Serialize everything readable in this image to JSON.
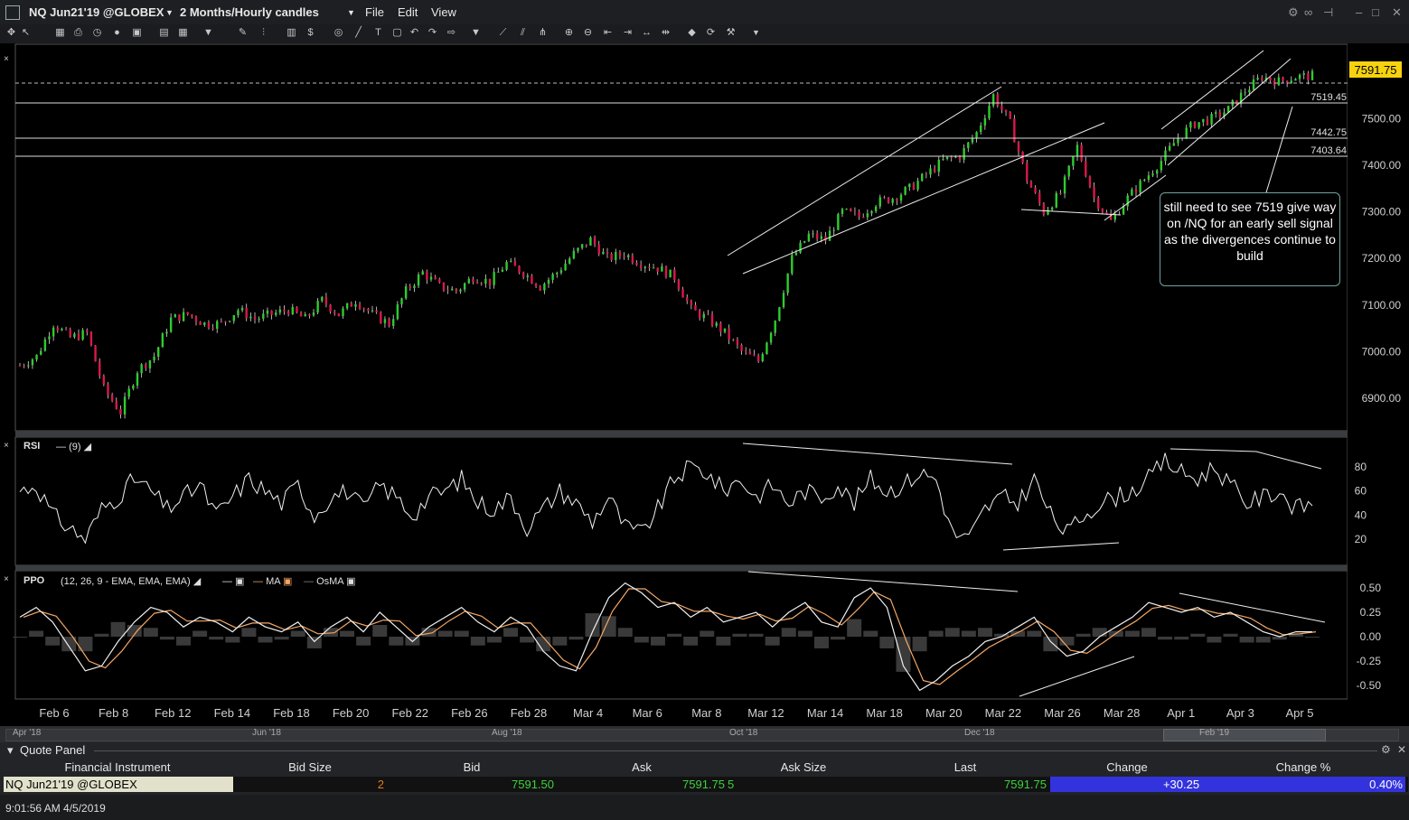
{
  "window": {
    "symbol": "NQ Jun21'19 @GLOBEX",
    "timeframe": "2 Months/Hourly candles",
    "menu": [
      "File",
      "Edit",
      "View"
    ]
  },
  "chart_data": [
    {
      "type": "line",
      "title": "",
      "x_labels": [
        "Feb 6",
        "Feb 8",
        "Feb 12",
        "Feb 14",
        "Feb 18",
        "Feb 20",
        "Feb 22",
        "Feb 26",
        "Feb 28",
        "Mar 4",
        "Mar 6",
        "Mar 8",
        "Mar 12",
        "Mar 14",
        "Mar 18",
        "Mar 20",
        "Mar 22",
        "Mar 26",
        "Mar 28",
        "Apr 1",
        "Apr 3",
        "Apr 5"
      ],
      "y_ticks": [
        "7500.00",
        "7400.00",
        "7300.00",
        "7200.00",
        "7100.00",
        "7000.00",
        "6900.00"
      ],
      "ylim": [
        6830,
        7660
      ],
      "series": [
        {
          "values": [
            6970,
            6990,
            7060,
            7030,
            7040,
            6920,
            6870,
            6960,
            6990,
            7070,
            7080,
            7060,
            7060,
            7090,
            7070,
            7080,
            7090,
            7070,
            7110,
            7080,
            7110,
            7080,
            7060,
            7130,
            7170,
            7140,
            7130,
            7160,
            7150,
            7190,
            7170,
            7140,
            7170,
            7210,
            7240,
            7200,
            7210,
            7190,
            7180,
            7160,
            7090,
            7070,
            7040,
            7000,
            6980,
            7070,
            7200,
            7250,
            7240,
            7300,
            7290,
            7320,
            7330,
            7350,
            7380,
            7410,
            7420,
            7470,
            7550,
            7490,
            7370,
            7300,
            7340,
            7440,
            7330,
            7280,
            7330,
            7370,
            7410,
            7460,
            7490,
            7500,
            7520,
            7560,
            7590,
            7580,
            7590,
            7592
          ]
        }
      ],
      "price_label": "7591.75",
      "horizontal_levels": [
        "7519.45",
        "7442.75",
        "7403.64"
      ],
      "annotation": "still need to see 7519 give way on /NQ for an early sell signal as the divergences continue to build"
    },
    {
      "type": "line",
      "title": "RSI",
      "legend": "(9)",
      "y_ticks": [
        "80",
        "60",
        "40",
        "20"
      ],
      "ylim": [
        0,
        100
      ],
      "series": [
        {
          "values": [
            60,
            65,
            40,
            30,
            20,
            45,
            55,
            70,
            60,
            45,
            55,
            65,
            40,
            55,
            70,
            60,
            50,
            65,
            40,
            55,
            60,
            45,
            65,
            55,
            40,
            55,
            60,
            70,
            50,
            45,
            55,
            30,
            45,
            60,
            50,
            35,
            55,
            30,
            25,
            45,
            70,
            80,
            75,
            60,
            70,
            55,
            65,
            50,
            60,
            55,
            65,
            50,
            70,
            60,
            65,
            75,
            70,
            25,
            20,
            45,
            55,
            50,
            70,
            40,
            25,
            40,
            50,
            55,
            60,
            70,
            85,
            75,
            70,
            80,
            65,
            50,
            55,
            60,
            45,
            50
          ]
        }
      ]
    },
    {
      "type": "line",
      "title": "PPO",
      "legend": "(12, 26, 9 - EMA, EMA, EMA)",
      "legend_items": [
        "MA",
        "OsMA"
      ],
      "y_ticks": [
        "0.50",
        "0.25",
        "0.00",
        "-0.25",
        "-0.50"
      ],
      "ylim": [
        -0.62,
        0.62
      ],
      "series": [
        {
          "values": [
            0.2,
            0.3,
            0.15,
            -0.1,
            -0.35,
            -0.3,
            -0.05,
            0.15,
            0.3,
            0.25,
            0.1,
            0.2,
            0.15,
            0.05,
            0.2,
            0.1,
            0.05,
            0.15,
            -0.05,
            0.1,
            0.2,
            0.05,
            0.25,
            0.1,
            -0.05,
            0.1,
            0.2,
            0.3,
            0.15,
            0.05,
            0.2,
            0.1,
            -0.15,
            -0.3,
            -0.35,
            0.05,
            0.4,
            0.55,
            0.45,
            0.3,
            0.35,
            0.2,
            0.3,
            0.15,
            0.2,
            0.25,
            0.1,
            0.25,
            0.35,
            0.15,
            0.1,
            0.4,
            0.5,
            0.3,
            -0.3,
            -0.55,
            -0.45,
            -0.3,
            -0.2,
            -0.05,
            0.0,
            0.1,
            0.2,
            -0.05,
            -0.2,
            -0.15,
            0.0,
            0.1,
            0.2,
            0.35,
            0.3,
            0.25,
            0.3,
            0.2,
            0.25,
            0.15,
            0.05,
            0.0,
            0.05,
            0.05
          ]
        }
      ]
    }
  ],
  "navigator": [
    "Apr '18",
    "Jun '18",
    "Aug '18",
    "Oct '18",
    "Dec '18",
    "Feb '19"
  ],
  "quote_panel": {
    "title": "Quote Panel",
    "headers": [
      "Financial Instrument",
      "Bid Size",
      "Bid",
      "Ask",
      "Ask Size",
      "Last",
      "Change",
      "Change %"
    ],
    "row": {
      "instrument": "NQ Jun21'19 @GLOBEX",
      "bid_size": "2",
      "bid": "7591.50",
      "ask": "7591.75",
      "ask_size": "5",
      "last": "7591.75",
      "change": "+30.25",
      "change_pct": "0.40%"
    }
  },
  "status": {
    "clock": "9:01:56 AM 4/5/2019"
  },
  "colors": {
    "up": "#2ecc2e",
    "down": "#d8194a",
    "annotation_border": "#6fa3a3",
    "change_bg": "#3333dd",
    "price_tag": "#f7d20f"
  }
}
